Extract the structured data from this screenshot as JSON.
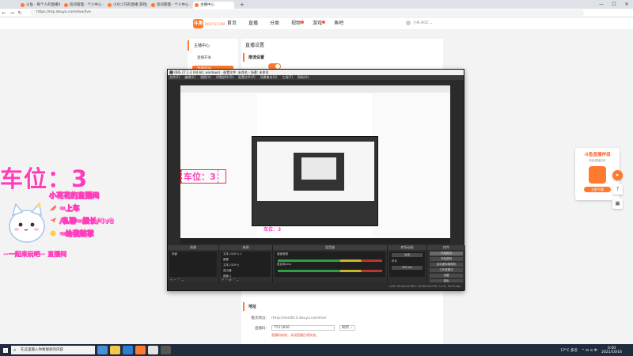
{
  "browser": {
    "tabs": [
      {
        "label": "斗鱼 - 每个人的直播平台",
        "active": false
      },
      {
        "label": "房间管理 - 个人中心 - 斗鱼",
        "active": false
      },
      {
        "label": "小众少巧的直播 游戏直播",
        "active": false
      },
      {
        "label": "房间管理 - 个人中心 - 斗鱼",
        "active": false
      },
      {
        "label": "主播中心",
        "active": true
      }
    ],
    "new_tab": "+",
    "url": "https://mp.douyu.com/live/live",
    "controls": [
      "—",
      "☐",
      "✕"
    ]
  },
  "site": {
    "logo": "斗鱼",
    "logo_sub": "DOUYU.COM",
    "nav": [
      "首页",
      "直播",
      "分类",
      "视频",
      "游戏",
      "鱼吧"
    ],
    "nav_badges": [
      false,
      false,
      false,
      true,
      true,
      false
    ],
    "user": "小M.HOC ⌄",
    "sidebar_title": "主播中心",
    "sidebar_items": [
      {
        "label": "直播开关",
        "active": false
      },
      {
        "label": "直播列表",
        "active": true
      }
    ],
    "content_heading": "直播设置",
    "section_push": "推流设置",
    "section_addr": "地址",
    "addr_label": "推流地址：",
    "addr_value": "rtmp://sendtc3.douyu.com/live",
    "code_label": "直播码：",
    "code_value": "7511836",
    "code_select": "刷新 ⌄",
    "warn": "直播码有效，关闭直播后将失效。"
  },
  "overlay": {
    "title": "车位：3",
    "lines": [
      "小花花的直播间",
      "=上车",
      "/私聊=舰长/4v8",
      "=给我鼓掌"
    ],
    "bottom": "~一起来玩吧~  直播间"
  },
  "obs": {
    "title": "OBS 27.1.3 (64-bit, windows) - 配置文件: 未命名 - 场景: 未命名",
    "menu": [
      "文件(F)",
      "编辑(E)",
      "视图(V)",
      "停靠部件(D)",
      "配置文件(P)",
      "场景集合(S)",
      "工具(T)",
      "帮助(H)"
    ],
    "docks": [
      "场景",
      "来源",
      "混音器",
      "转场动画",
      "控件"
    ],
    "scene_item": "场景",
    "sources": [
      "文本 (GDI+) 2",
      "图像",
      "文本 (GDI+)",
      "显示器",
      "图像 2"
    ],
    "mixer": [
      "桌面音频",
      "麦克风/Aux"
    ],
    "transition": [
      "淡出",
      "时长",
      "300 ms"
    ],
    "controls": [
      "开始推流",
      "开始录制",
      "启动虚拟摄像机",
      "工作室模式",
      "设置",
      "退出"
    ],
    "status": "LIVE: 00:00:00   REC: 00:00:00   CPU: 3.1%, 30.00 fps"
  },
  "preview": {
    "title": "车位：3"
  },
  "promo": {
    "title": "斗鱼直播伴侣",
    "sub": "新版直播伴侣",
    "btn": "立即下载"
  },
  "taskbar": {
    "search": "在这里输入你要搜索的内容",
    "weather": "17°C 多云",
    "tray": "^ ⊡ ⊙ 中",
    "time": "0:00",
    "date": "2021/10/16"
  }
}
